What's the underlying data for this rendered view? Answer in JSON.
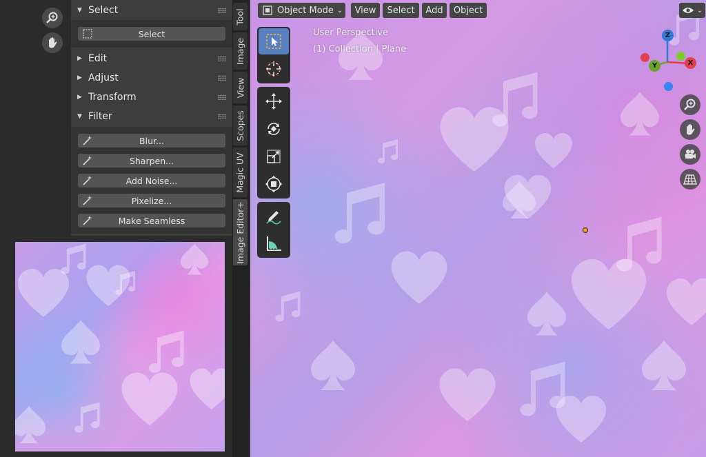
{
  "sidebar": {
    "sections": {
      "select": "Select",
      "edit": "Edit",
      "adjust": "Adjust",
      "transform": "Transform",
      "filter": "Filter"
    },
    "select_button": "Select",
    "filter_buttons": [
      "Blur...",
      "Sharpen...",
      "Add Noise...",
      "Pixelize...",
      "Make Seamless"
    ]
  },
  "tabs": [
    "Tool",
    "Image",
    "View",
    "Scopes",
    "Magic UV",
    "Image Editor+"
  ],
  "viewport": {
    "mode": "Object Mode",
    "menus": [
      "View",
      "Select",
      "Add",
      "Object"
    ],
    "perspective": "User Perspective",
    "collection": "(1) Collection | Plane",
    "gizmo_axes": [
      "Z",
      "Y",
      "X"
    ]
  },
  "colors": {
    "accent": "#5680c2",
    "axis_x": "#e0404f",
    "axis_y": "#6aa32a",
    "axis_z": "#2f7ad6"
  }
}
